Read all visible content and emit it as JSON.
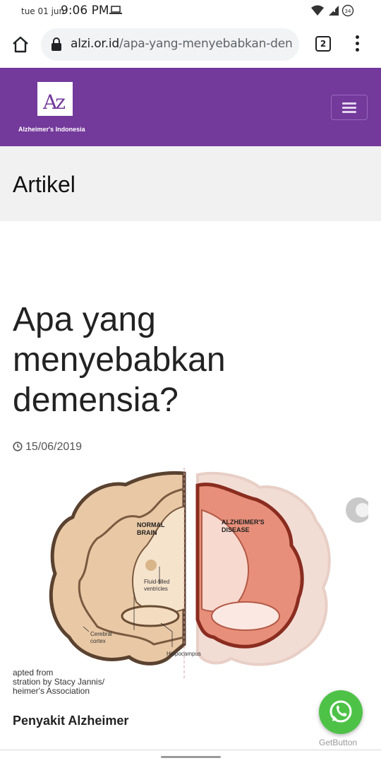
{
  "status_bar": {
    "date": "tue 01 jun",
    "time": "9:06 PM",
    "battery": "34"
  },
  "browser": {
    "url_domain": "alzi.or.id",
    "url_path": "/apa-yang-menyebabkan-den",
    "tab_count": "2"
  },
  "site": {
    "logo_letters": "Az",
    "logo_caption": "Alzheimer's Indonesia",
    "brand_color": "#73399b"
  },
  "page": {
    "section_title": "Artikel"
  },
  "article": {
    "title": "Apa yang menyebabkan demensia?",
    "date": "15/06/2019",
    "figure": {
      "label_normal": [
        "NORMAL",
        "BRAIN"
      ],
      "label_disease": [
        "ALZHEIMER'S",
        "DISEASE"
      ],
      "label_ventricles": [
        "Fluid-filled",
        "ventricles"
      ],
      "label_cortex": [
        "Cerebral",
        "cortex"
      ],
      "label_hippocampus": "Hippocampus"
    },
    "credit_lines": [
      "apted from",
      "stration by Stacy Jannis/",
      "heimer's Association"
    ],
    "subheading": "Penyakit Alzheimer"
  },
  "widget": {
    "label": "GetButton",
    "color": "#4dc247"
  }
}
